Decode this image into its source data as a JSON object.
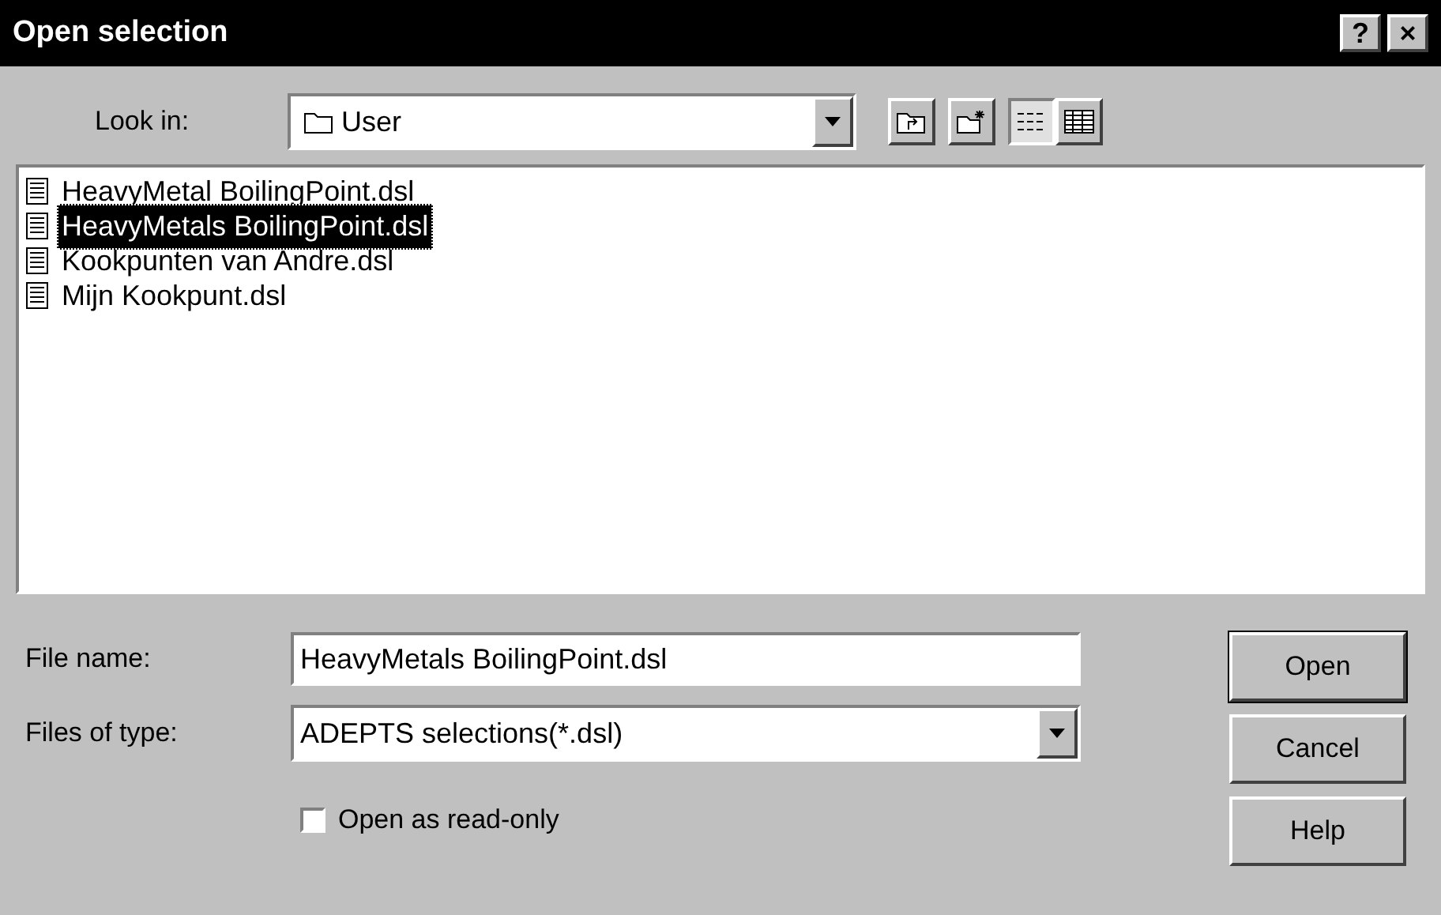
{
  "window": {
    "title": "Open selection",
    "controls": [
      "?",
      "×"
    ]
  },
  "look_in": {
    "label": "Look in:",
    "value": "User"
  },
  "files": [
    {
      "name": "HeavyMetal BoilingPoint.dsl",
      "selected": false
    },
    {
      "name": "HeavyMetals BoilingPoint.dsl",
      "selected": true
    },
    {
      "name": "Kookpunten van Andre.dsl",
      "selected": false
    },
    {
      "name": "Mijn Kookpunt.dsl",
      "selected": false
    }
  ],
  "file_name": {
    "label": "File name:",
    "value": "HeavyMetals BoilingPoint.dsl"
  },
  "file_type": {
    "label": "Files of type:",
    "value": "ADEPTS selections(*.dsl)"
  },
  "read_only": {
    "label": "Open as read-only",
    "checked": false
  },
  "buttons": [
    "Open",
    "Cancel",
    "Help"
  ]
}
